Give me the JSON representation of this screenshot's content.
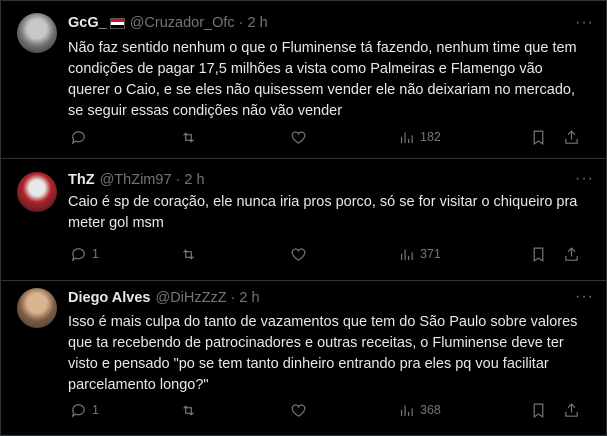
{
  "tweets": [
    {
      "name": "GcG_",
      "handle": "@Cruzador_Ofc",
      "time": "2 h",
      "text": "Não faz sentido nenhum o que o Fluminense tá fazendo, nenhum time que tem condições de pagar 17,5 milhões a vista como Palmeiras e Flamengo vão querer o Caio, e se eles não quisessem vender ele não deixariam no mercado, se seguir essas condições não vão vender",
      "replies": "",
      "views": "182"
    },
    {
      "name": "ThZ",
      "handle": "@ThZim97",
      "time": "2 h",
      "text": "Caio é sp de coração, ele nunca iria pros porco, só se for visitar o chiqueiro pra meter gol msm",
      "replies": "1",
      "views": "371"
    },
    {
      "name": "Diego Alves",
      "handle": "@DiHzZzZ",
      "time": "2 h",
      "text": "Isso é mais culpa do tanto de vazamentos que tem do São Paulo sobre valores que ta recebendo de patrocinadores e outras receitas, o Fluminense deve ter visto e pensado \"po se tem tanto dinheiro entrando pra eles pq vou facilitar parcelamento longo?\"",
      "replies": "1",
      "views": "368"
    }
  ],
  "separator": "·",
  "more_glyph": "···",
  "colors": {
    "background": "#000000",
    "text": "#e7e9ea",
    "muted": "#71767b",
    "border": "#2f3336"
  },
  "icons": [
    "reply-icon",
    "retweet-icon",
    "like-icon",
    "views-icon",
    "bookmark-icon",
    "share-icon",
    "more-icon",
    "flag-icon"
  ]
}
